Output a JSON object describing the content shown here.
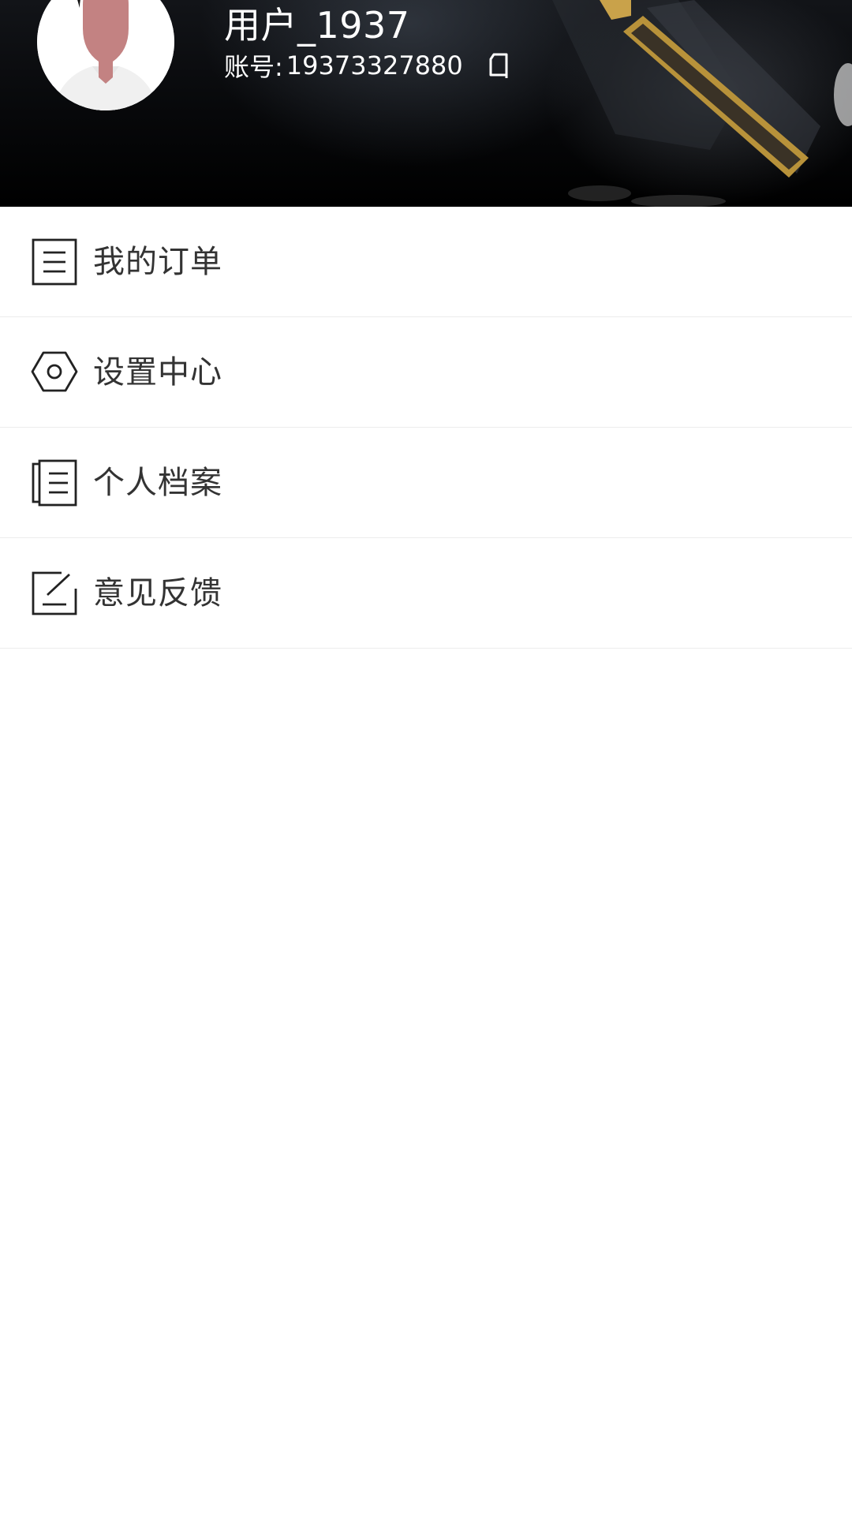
{
  "header": {
    "user_name": "用户_1937",
    "account_label": "账号:",
    "account_number": "19373327880",
    "copy_icon": "copy-icon",
    "avatar_icon": "default-avatar"
  },
  "menu": {
    "items": [
      {
        "label": "我的订单",
        "icon": "order-list-icon"
      },
      {
        "label": "设置中心",
        "icon": "settings-hexagon-icon"
      },
      {
        "label": "个人档案",
        "icon": "profile-documents-icon"
      },
      {
        "label": "意见反馈",
        "icon": "feedback-edit-icon"
      }
    ]
  },
  "colors": {
    "header_bg": "#000000",
    "header_text": "#ffffff",
    "menu_text": "#333333",
    "divider": "#ececec",
    "avatar_skin": "#c08080"
  }
}
